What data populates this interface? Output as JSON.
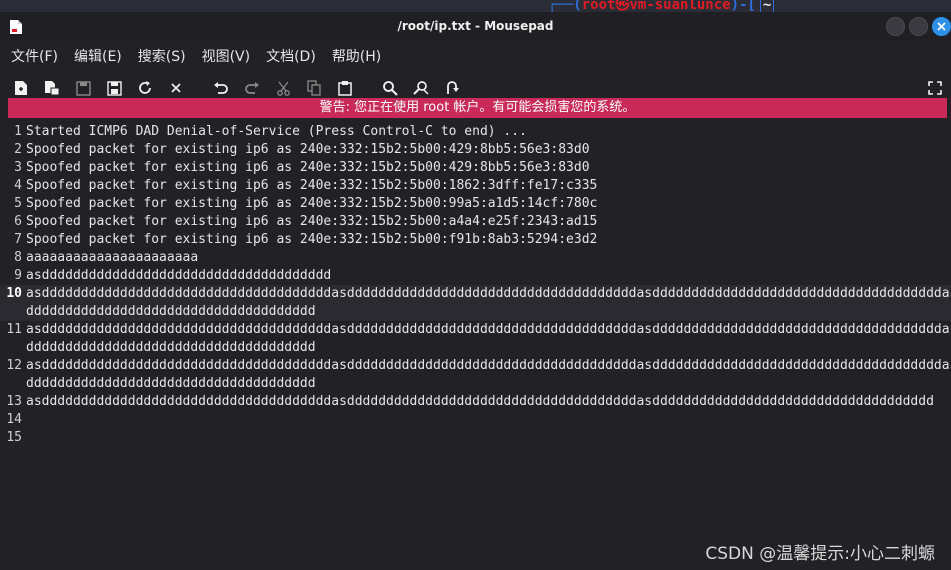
{
  "background": {
    "terminal_prompt_user": "root㉿vm-suanlunce",
    "terminal_tilde": "~"
  },
  "window": {
    "title": "/root/ip.txt - Mousepad"
  },
  "menu": {
    "items": [
      "文件(F)",
      "编辑(E)",
      "搜索(S)",
      "视图(V)",
      "文档(D)",
      "帮助(H)"
    ]
  },
  "toolbar": {
    "buttons": [
      "new-document-icon",
      "new-window-icon",
      "save-icon",
      "save-as-icon",
      "reload-icon",
      "close-document-icon",
      "undo-icon",
      "redo-icon",
      "cut-icon",
      "copy-icon",
      "paste-icon",
      "find-icon",
      "find-replace-icon",
      "go-to-line-icon",
      "fullscreen-icon"
    ]
  },
  "warning": {
    "text": "警告: 您正在使用 root 帐户。有可能会损害您的系统。"
  },
  "editor": {
    "current_line": 10,
    "lines": [
      {
        "n": "1",
        "text": "Started ICMP6 DAD Denial-of-Service (Press Control-C to end) ..."
      },
      {
        "n": "2",
        "text": "Spoofed packet for existing ip6 as 240e:332:15b2:5b00:429:8bb5:56e3:83d0"
      },
      {
        "n": "3",
        "text": "Spoofed packet for existing ip6 as 240e:332:15b2:5b00:429:8bb5:56e3:83d0"
      },
      {
        "n": "4",
        "text": "Spoofed packet for existing ip6 as 240e:332:15b2:5b00:1862:3dff:fe17:c335"
      },
      {
        "n": "5",
        "text": "Spoofed packet for existing ip6 as 240e:332:15b2:5b00:99a5:a1d5:14cf:780c"
      },
      {
        "n": "6",
        "text": "Spoofed packet for existing ip6 as 240e:332:15b2:5b00:a4a4:e25f:2343:ad15"
      },
      {
        "n": "7",
        "text": "Spoofed packet for existing ip6 as 240e:332:15b2:5b00:f91b:8ab3:5294:e3d2"
      },
      {
        "n": "8",
        "text": "aaaaaaaaaaaaaaaaaaaaaa"
      },
      {
        "n": "9",
        "text": "asddddddddddddddddddddddddddddddddddddd"
      },
      {
        "n": "10",
        "text": "asdddddddddddddddddddddddddddddddddddddasdddddddddddddddddddddddddddddddddddddasdddddddddddddddddddddddddddddddddddddasd-",
        "cont": "ddddddddddddddddddddddddddddddddddddd"
      },
      {
        "n": "11",
        "text": "asdddddddddddddddddddddddddddddddddddddasdddddddddddddddddddddddddddddddddddddasdddddddddddddddddddddddddddddddddddddasd-",
        "cont": "ddddddddddddddddddddddddddddddddddddd"
      },
      {
        "n": "12",
        "text": "asdddddddddddddddddddddddddddddddddddddasdddddddddddddddddddddddddddddddddddddasdddddddddddddddddddddddddddddddddddddasd-",
        "cont": "ddddddddddddddddddddddddddddddddddddd"
      },
      {
        "n": "13",
        "text": "asdddddddddddddddddddddddddddddddddddddasdddddddddddddddddddddddddddddddddddddasdddddddddddddddddddddddddddddddddddd"
      },
      {
        "n": "14",
        "text": ""
      },
      {
        "n": "15",
        "text": ""
      }
    ]
  },
  "watermark": {
    "text": "CSDN @温馨提示:小心二刺螈"
  },
  "colors": {
    "warning_bg": "#c92a5a",
    "close_button": "#2e90e8",
    "prompt_user": "#e01b24"
  }
}
